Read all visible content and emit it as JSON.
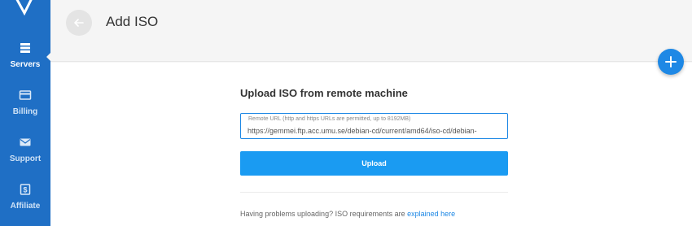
{
  "sidebar": {
    "items": [
      {
        "label": "Servers",
        "icon": "servers-icon",
        "active": true
      },
      {
        "label": "Billing",
        "icon": "credit-card-icon",
        "active": false
      },
      {
        "label": "Support",
        "icon": "envelope-icon",
        "active": false
      },
      {
        "label": "Affiliate",
        "icon": "dollar-icon",
        "active": false
      }
    ]
  },
  "header": {
    "title": "Add ISO"
  },
  "upload": {
    "heading": "Upload ISO from remote machine",
    "url_label": "Remote URL (http and https URLs are permitted, up to 8192MB)",
    "url_value": "https://gemmei.ftp.acc.umu.se/debian-cd/current/amd64/iso-cd/debian-",
    "button_label": "Upload"
  },
  "help": {
    "text": "Having problems uploading? ISO requirements are ",
    "link_text": "explained here"
  },
  "colors": {
    "sidebar": "#1f6fc5",
    "accent": "#1e88e5",
    "button": "#1a9bf2"
  }
}
